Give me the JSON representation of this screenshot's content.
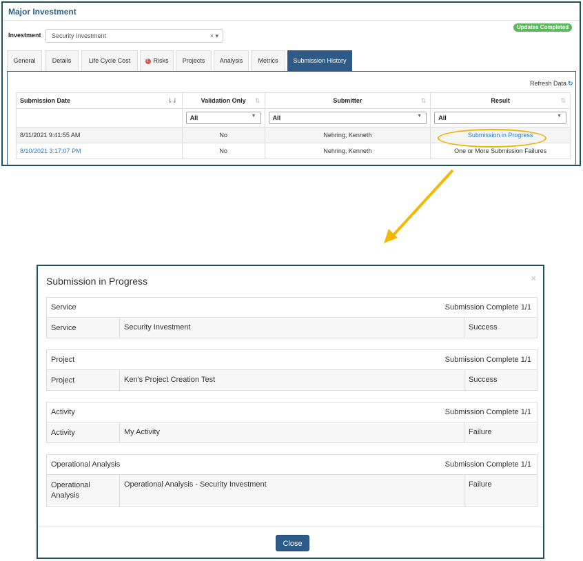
{
  "header": {
    "title": "Major Investment",
    "status_badge": "Updates Completed"
  },
  "investment": {
    "label": "Investment",
    "value": "Security Investment",
    "clear_icon": "×",
    "caret_icon": "▾"
  },
  "tabs": [
    {
      "label": "General"
    },
    {
      "label": "Details"
    },
    {
      "label": "Life Cycle Cost"
    },
    {
      "label": "Risks",
      "icon": "!"
    },
    {
      "label": "Projects"
    },
    {
      "label": "Analysis"
    },
    {
      "label": "Metrics"
    },
    {
      "label": "Submission History",
      "active": true
    }
  ],
  "toolbar": {
    "refresh_label": "Refresh Data",
    "refresh_icon": "↻"
  },
  "grid": {
    "columns": [
      "Submission Date",
      "Validation Only",
      "Submitter",
      "Result"
    ],
    "filters": {
      "validation": "All",
      "submitter": "All",
      "result": "All"
    },
    "rows": [
      {
        "date": "8/11/2021 9:41:55 AM",
        "validation": "No",
        "submitter": "Nehring, Kenneth",
        "result": "Submission in Progress"
      },
      {
        "date": "8/10/2021 3:17:07 PM",
        "validation": "No",
        "submitter": "Nehring, Kenneth",
        "result": "One or More Submission Failures"
      }
    ]
  },
  "modal": {
    "title": "Submission in Progress",
    "close_icon": "×",
    "close_label": "Close",
    "sections": [
      {
        "name": "Service",
        "status": "Submission Complete  1/1",
        "type": "Service",
        "item": "Security Investment",
        "result": "Success"
      },
      {
        "name": "Project",
        "status": "Submission Complete  1/1",
        "type": "Project",
        "item": "Ken's Project Creation Test",
        "result": "Success"
      },
      {
        "name": "Activity",
        "status": "Submission Complete  1/1",
        "type": "Activity",
        "item": "My Activity",
        "result": "Failure"
      },
      {
        "name": "Operational Analysis",
        "status": "Submission Complete  1/1",
        "type": "Operational Analysis",
        "item": "Operational Analysis - Security Investment",
        "result": "Failure"
      }
    ]
  },
  "colors": {
    "accent": "#2d5a86",
    "highlight": "#f0b400",
    "badge": "#5cb85c",
    "link": "#2d7bd8"
  }
}
